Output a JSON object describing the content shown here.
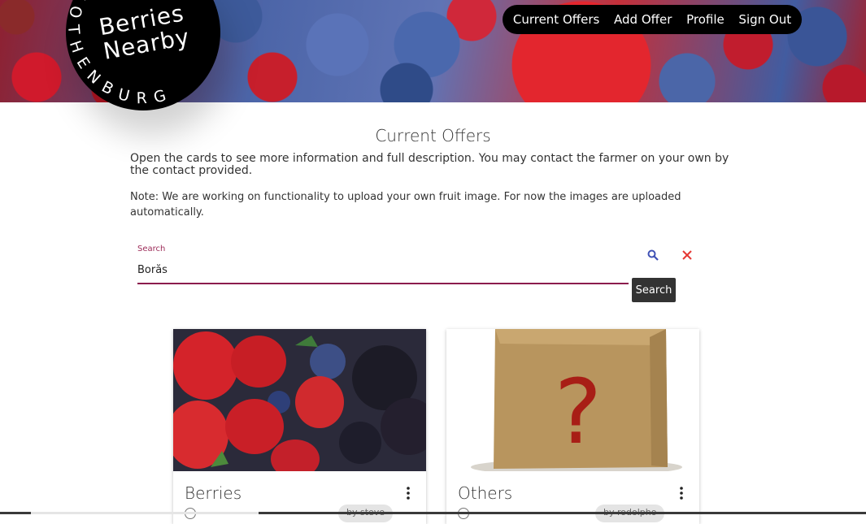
{
  "logo": {
    "line1": "Berries",
    "line2": "Nearby",
    "arc_text": "GOTHENBURG"
  },
  "nav": {
    "items": [
      "Current Offers",
      "Add Offer",
      "Profile",
      "Sign Out"
    ]
  },
  "page": {
    "title": "Current Offers",
    "intro": "Open the cards to see more information and full description. You may contact the farmer on your own by the contact provided.",
    "note": "Note: We are working on functionality to upload your own fruit image. For now the images are uploaded automatically."
  },
  "search": {
    "label": "Search",
    "value": "Borås",
    "button_label": "Search",
    "search_icon": "search-icon",
    "clear_icon": "close-icon"
  },
  "cards": [
    {
      "title": "Berries",
      "owner": "by steve",
      "image": "berries-photo"
    },
    {
      "title": "Others",
      "owner": "by rodolpho",
      "image": "mystery-box-photo"
    }
  ],
  "colors": {
    "accent": "#8b1c4d",
    "clear_icon": "#e53935",
    "search_icon": "#3f51b5",
    "nav_bg": "#000000"
  }
}
